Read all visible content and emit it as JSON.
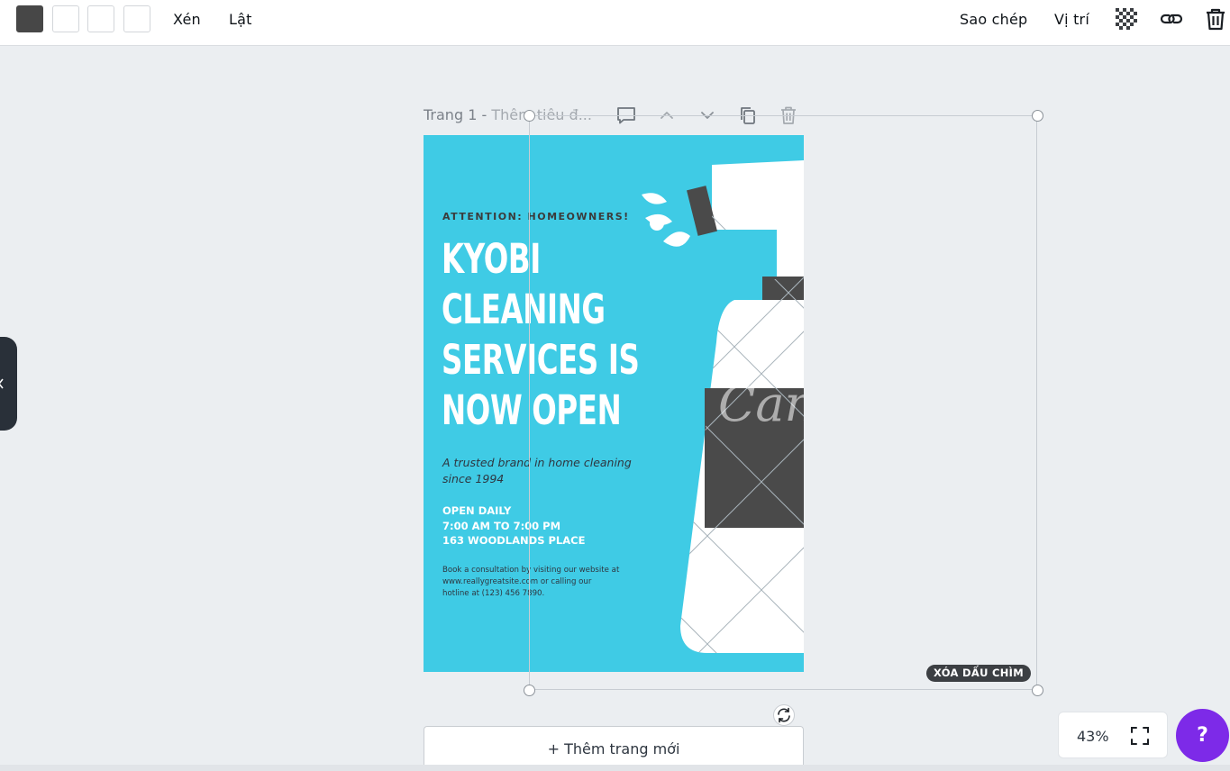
{
  "toolbar": {
    "swatches": [
      "#474747",
      "#ffffff",
      "#ffffff",
      "#ffffff"
    ],
    "crop_label": "Xén",
    "flip_label": "Lật",
    "copy_style_label": "Sao chép",
    "position_label": "Vị trí",
    "icons": [
      "transparency-icon",
      "link-icon",
      "trash-icon"
    ]
  },
  "page": {
    "title": "Trang 1 - ",
    "title_placeholder": "Thêm tiêu đ...",
    "header_icons": [
      "comment-icon",
      "chevron-up-icon",
      "chevron-down-icon",
      "duplicate-icon",
      "trash-icon"
    ]
  },
  "design": {
    "background": "#3fcbe5",
    "attention": "ATTENTION: HOMEOWNERS!",
    "headline": [
      "KYOBI",
      "CLEANING",
      "SERVICES IS",
      "NOW OPEN"
    ],
    "tagline": "A trusted brand in home cleaning since 1994",
    "hours": [
      "OPEN DAILY",
      "7:00 AM TO 7:00 PM",
      "163 WOODLANDS PLACE"
    ],
    "book_lines": [
      "Book a consultation by visiting our website at",
      "www.reallygreatsite.com or calling our",
      "hotline at (123) 456 7890."
    ],
    "watermark": "Can"
  },
  "watermark_button": "XÓA DẤU CHÌM",
  "add_page_label": "+ Thêm trang mới",
  "zoom": {
    "value": "43%"
  },
  "help_label": "?"
}
